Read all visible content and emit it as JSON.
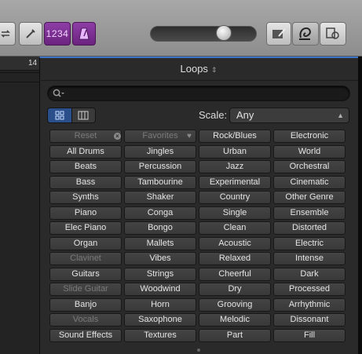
{
  "toolbar": {
    "counter_label": "1234",
    "buttons": [
      {
        "name": "cycle-icon"
      },
      {
        "name": "tuner-icon"
      },
      {
        "name": "metronome-icon"
      },
      {
        "name": "notepad-icon"
      },
      {
        "name": "loop-browser-icon"
      },
      {
        "name": "browser-icon"
      }
    ]
  },
  "timeline": {
    "ruler_number": "14"
  },
  "panel": {
    "title": "Loops",
    "title_arrows": "⇕"
  },
  "search": {
    "placeholder": "",
    "value": ""
  },
  "view": {
    "active": "button-view"
  },
  "scale": {
    "label": "Scale:",
    "value": "Any"
  },
  "keywords": [
    [
      "Reset",
      "Favorites",
      "Rock/Blues",
      "Electronic"
    ],
    [
      "All Drums",
      "Jingles",
      "Urban",
      "World"
    ],
    [
      "Beats",
      "Percussion",
      "Jazz",
      "Orchestral"
    ],
    [
      "Bass",
      "Tambourine",
      "Experimental",
      "Cinematic"
    ],
    [
      "Synths",
      "Shaker",
      "Country",
      "Other Genre"
    ],
    [
      "Piano",
      "Conga",
      "Single",
      "Ensemble"
    ],
    [
      "Elec Piano",
      "Bongo",
      "Clean",
      "Distorted"
    ],
    [
      "Organ",
      "Mallets",
      "Acoustic",
      "Electric"
    ],
    [
      "Clavinet",
      "Vibes",
      "Relaxed",
      "Intense"
    ],
    [
      "Guitars",
      "Strings",
      "Cheerful",
      "Dark"
    ],
    [
      "Slide Guitar",
      "Woodwind",
      "Dry",
      "Processed"
    ],
    [
      "Banjo",
      "Horn",
      "Grooving",
      "Arrhythmic"
    ],
    [
      "Vocals",
      "Saxophone",
      "Melodic",
      "Dissonant"
    ],
    [
      "Sound Effects",
      "Textures",
      "Part",
      "Fill"
    ]
  ],
  "dimmed": [
    "Reset",
    "Favorites",
    "Clavinet",
    "Slide Guitar",
    "Vocals"
  ],
  "colors": {
    "accent": "#3e74c8",
    "counter": "#7a2e90",
    "panel_bg": "#2a2a2a"
  }
}
